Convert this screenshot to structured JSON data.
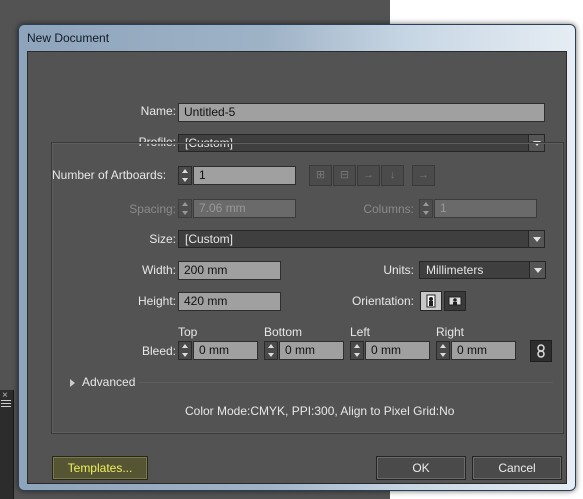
{
  "window": {
    "title": "New Document"
  },
  "fields": {
    "name": {
      "label": "Name:",
      "value": "Untitled-5"
    },
    "profile": {
      "label": "Profile:",
      "value": "[Custom]"
    },
    "artboards": {
      "label": "Number of Artboards:",
      "value": "1"
    },
    "spacing": {
      "label": "Spacing:",
      "value": "7.06 mm"
    },
    "columns": {
      "label": "Columns:",
      "value": "1"
    },
    "size": {
      "label": "Size:",
      "value": "[Custom]"
    },
    "width": {
      "label": "Width:",
      "value": "200 mm"
    },
    "height": {
      "label": "Height:",
      "value": "420 mm"
    },
    "units": {
      "label": "Units:",
      "value": "Millimeters"
    },
    "orientation": {
      "label": "Orientation:",
      "selected": "portrait"
    }
  },
  "bleed": {
    "label": "Bleed:",
    "top": {
      "label": "Top",
      "value": "0 mm"
    },
    "bottom": {
      "label": "Bottom",
      "value": "0 mm"
    },
    "left": {
      "label": "Left",
      "value": "0 mm"
    },
    "right": {
      "label": "Right",
      "value": "0 mm"
    }
  },
  "advanced": {
    "label": "Advanced"
  },
  "info": {
    "text": "Color Mode:CMYK, PPI:300, Align to Pixel Grid:No"
  },
  "buttons": {
    "templates": "Templates...",
    "ok": "OK",
    "cancel": "Cancel"
  },
  "colors": {
    "dialog_bg": "#535353",
    "field_bg": "#a0a0a0",
    "templates_text": "#f0f060"
  }
}
